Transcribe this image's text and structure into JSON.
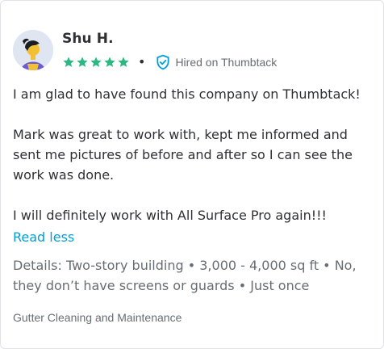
{
  "review": {
    "author": "Shu H.",
    "rating": 5,
    "max_rating": 5,
    "separator": "•",
    "hired_label": "Hired on Thumbtack",
    "paragraphs": [
      "I am glad to have found this company on Thumbtack!",
      "Mark was great to work with, kept me informed and sent me pictures of before and after so I can see the work was done.",
      "I will definitely work with All Surface Pro again!!!"
    ],
    "read_less_label": "Read less",
    "details": "Details: Two-story building • 3,000 - 4,000 sq ft • No, they don’t have screens or guards • Just once",
    "category": "Gutter Cleaning and Maintenance"
  },
  "icons": {
    "avatar": "avatar-illustration",
    "star": "star-icon",
    "shield": "verified-shield-icon"
  },
  "colors": {
    "star": "#2db783",
    "shield": "#009fd9",
    "link": "#009fd9",
    "text": "#2f3033",
    "muted": "#676d73",
    "avatar_bg": "#dfe6f2"
  }
}
